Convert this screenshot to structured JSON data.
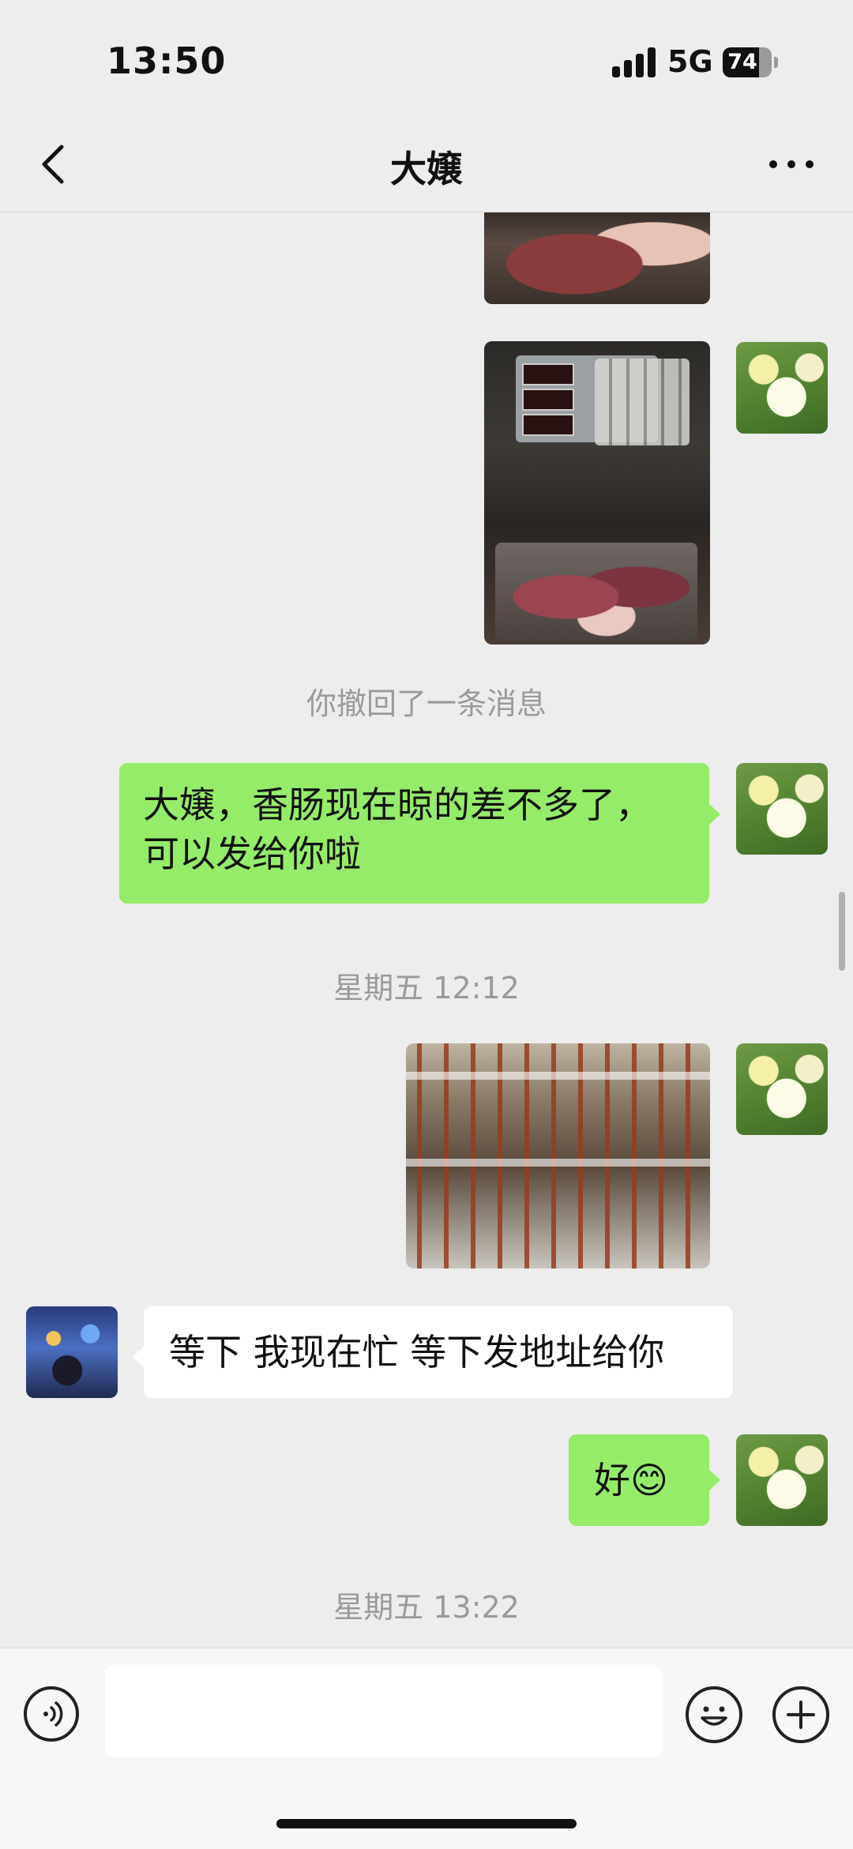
{
  "status_bar": {
    "time": "13:50",
    "network": "5G",
    "battery_level": "74",
    "battery_fraction": 0.74
  },
  "nav": {
    "title": "大嬢"
  },
  "messages": {
    "recall_notice": "你撤回了一条消息",
    "text_1": "大嬢，香肠现在晾的差不多了，",
    "text_1_line2": "可以发给你啦",
    "timestamp_1": "星期五 12:12",
    "reply_1": "等下 我现在忙 等下发地址给你",
    "text_2": "好😊",
    "timestamp_2": "星期五 13:22"
  },
  "input": {
    "value": "",
    "placeholder": ""
  },
  "colors": {
    "my_bubble": "#95ec69",
    "their_bubble": "#ffffff",
    "background": "#ededed"
  },
  "icons": {
    "back": "chevron-left-icon",
    "more": "more-dots-icon",
    "voice": "voice-icon",
    "emoji": "emoji-icon",
    "plus": "plus-icon"
  }
}
